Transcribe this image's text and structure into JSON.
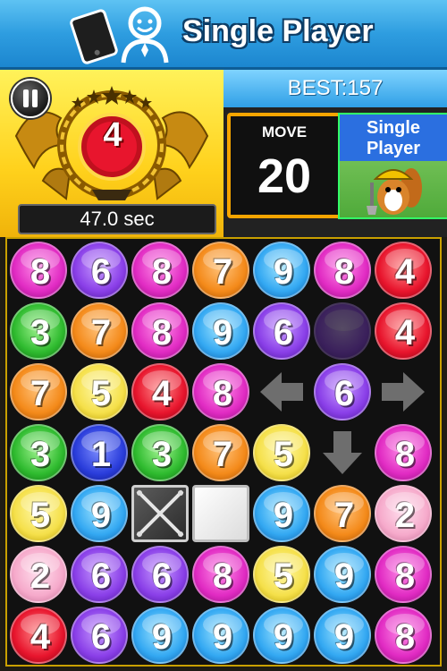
{
  "header": {
    "title": "Single Player"
  },
  "panel": {
    "level": "4",
    "timer": "47.0 sec",
    "best": "BEST:157",
    "move_label": "MOVE",
    "move_value": "20",
    "mode_label": "Single Player"
  },
  "board": {
    "rows": [
      [
        {
          "n": "8",
          "color": "pink"
        },
        {
          "n": "6",
          "color": "purple"
        },
        {
          "n": "8",
          "color": "pink"
        },
        {
          "n": "7",
          "color": "orange"
        },
        {
          "n": "9",
          "color": "blue"
        },
        {
          "n": "8",
          "color": "pink"
        },
        {
          "n": "4",
          "color": "red"
        }
      ],
      [
        {
          "n": "3",
          "color": "green"
        },
        {
          "n": "7",
          "color": "orange"
        },
        {
          "n": "8",
          "color": "pink"
        },
        {
          "n": "9",
          "color": "blue"
        },
        {
          "n": "6",
          "color": "purple"
        },
        {
          "n": "",
          "color": "ghost"
        },
        {
          "n": "4",
          "color": "red"
        }
      ],
      [
        {
          "n": "7",
          "color": "orange"
        },
        {
          "n": "5",
          "color": "yellow"
        },
        {
          "n": "4",
          "color": "red"
        },
        {
          "n": "8",
          "color": "pink"
        },
        {
          "n": "",
          "color": "arrow-left"
        },
        {
          "n": "6",
          "color": "purple"
        },
        {
          "n": "",
          "color": "arrow-right"
        }
      ],
      [
        {
          "n": "3",
          "color": "green"
        },
        {
          "n": "1",
          "color": "navy"
        },
        {
          "n": "3",
          "color": "green"
        },
        {
          "n": "7",
          "color": "orange"
        },
        {
          "n": "5",
          "color": "yellow"
        },
        {
          "n": "",
          "color": "arrow-down"
        },
        {
          "n": "8",
          "color": "pink"
        }
      ],
      [
        {
          "n": "5",
          "color": "yellow"
        },
        {
          "n": "9",
          "color": "blue"
        },
        {
          "n": "",
          "color": "block-metal"
        },
        {
          "n": "",
          "color": "block-white"
        },
        {
          "n": "9",
          "color": "blue"
        },
        {
          "n": "7",
          "color": "orange"
        },
        {
          "n": "2",
          "color": "lightpink"
        }
      ],
      [
        {
          "n": "2",
          "color": "lightpink"
        },
        {
          "n": "6",
          "color": "purple"
        },
        {
          "n": "6",
          "color": "purple"
        },
        {
          "n": "8",
          "color": "pink"
        },
        {
          "n": "5",
          "color": "yellow"
        },
        {
          "n": "9",
          "color": "blue"
        },
        {
          "n": "8",
          "color": "pink"
        }
      ],
      [
        {
          "n": "4",
          "color": "red"
        },
        {
          "n": "6",
          "color": "purple"
        },
        {
          "n": "9",
          "color": "blue"
        },
        {
          "n": "9",
          "color": "blue"
        },
        {
          "n": "9",
          "color": "blue"
        },
        {
          "n": "9",
          "color": "blue"
        },
        {
          "n": "8",
          "color": "pink"
        }
      ]
    ]
  },
  "colors": {
    "header_blue": "#2e9de0",
    "panel_yellow": "#ffd11c",
    "move_border": "#f6a500",
    "mode_blue": "#2b6fe0"
  }
}
